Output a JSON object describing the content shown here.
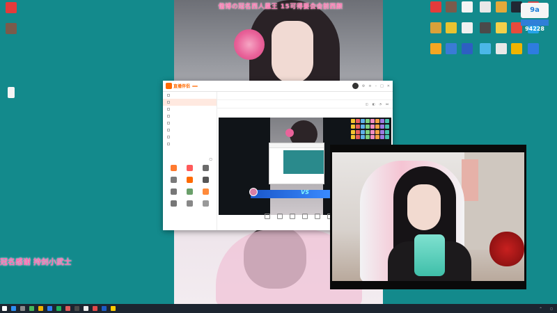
{
  "banner_text": "偕博の冠名西人凰王 15可得要会会前西颜",
  "gift_text": "冠名感谢 持剑小武士",
  "desktop_icons": [
    {
      "label": "",
      "color": "#e33b3b"
    },
    {
      "label": "",
      "color": "#7a5b4b"
    },
    {
      "label": "",
      "color": "#f4f4f4"
    },
    {
      "label": "",
      "color": "#e8e8e8"
    },
    {
      "label": "",
      "color": "#e5a93a"
    },
    {
      "label": "",
      "color": "#202833"
    },
    {
      "label": "",
      "color": "#d9a13a"
    },
    {
      "label": "",
      "color": "#e9c330"
    },
    {
      "label": "",
      "color": "#f0f0f0"
    },
    {
      "label": "",
      "color": "#4a4a4a"
    },
    {
      "label": "",
      "color": "#f3d04a"
    },
    {
      "label": "",
      "color": "#e64b3c"
    },
    {
      "label": "",
      "color": "#26a4e8"
    },
    {
      "label": "",
      "color": "#f5a623"
    },
    {
      "label": "",
      "color": "#3a7bd5"
    },
    {
      "label": "",
      "color": "#2d5fc2"
    },
    {
      "label": "",
      "color": "#4bb7e8"
    },
    {
      "label": "",
      "color": "#e8e8e8"
    },
    {
      "label": "",
      "color": "#f0b400"
    },
    {
      "label": "",
      "color": "#2e7ce0"
    },
    {
      "label": "",
      "color": "#d6484b"
    },
    {
      "label": "",
      "color": "#e8e8e8"
    },
    {
      "label": "",
      "color": "#8a8a8a"
    },
    {
      "label": "",
      "color": "#e8e8e8"
    },
    {
      "label": "",
      "color": "#e8e8e8"
    }
  ],
  "meter": {
    "icon_text": "9a",
    "bar_text": "",
    "value": "94228"
  },
  "app": {
    "logo": "直播伴侣",
    "pill": "",
    "tabs": [
      "",
      "",
      ""
    ],
    "scenes": [
      "",
      "",
      "",
      "",
      "",
      "",
      "",
      ""
    ],
    "tools_header": "",
    "tools": [
      "",
      "",
      "",
      "",
      "",
      "",
      "",
      "",
      "",
      "",
      "",
      ""
    ],
    "sidebar_footer": "",
    "toolbar_row1": [
      "",
      "",
      ""
    ],
    "toolbar_row2": [
      "",
      "",
      ""
    ],
    "pk_name": "",
    "pk_vs": "VS",
    "bottom_actions": [
      "",
      "",
      "",
      "",
      "",
      "",
      ""
    ]
  },
  "taskbar": {
    "time": "",
    "date": "",
    "weather": "",
    "lang": "",
    "app_colors": [
      "#2f8ff2",
      "#8b8b8b",
      "#46b85b",
      "#f2b200",
      "#2d7cf2",
      "#1fb05a",
      "#e25b5b",
      "#4a4a4a",
      "#eeeeee",
      "#e24a4a",
      "#1d5cc4",
      "#ffcc00"
    ]
  }
}
